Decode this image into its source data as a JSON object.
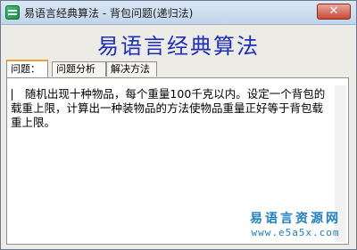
{
  "window": {
    "title": "易语言经典算法 - 背包问题(递归法)",
    "close_label": "✕"
  },
  "header": {
    "title": "易语言经典算法"
  },
  "tabs": [
    {
      "label": "问题：",
      "active": true
    },
    {
      "label": "问题分析",
      "active": false
    },
    {
      "label": "解决方法",
      "active": false
    }
  ],
  "content": {
    "text": "    随机出现十种物品，每个重量100千克以内。设定一个背包的载重上限，计算出一种装物品的方法使物品重量正好等于背包载重上限。"
  },
  "watermark": {
    "brand": "易语言资源网",
    "url": "www.e5a5x.com"
  },
  "colors": {
    "header_title": "#1f2fb8",
    "active_tab_accent": "#f0a030",
    "watermark": "#1f7fc0"
  }
}
